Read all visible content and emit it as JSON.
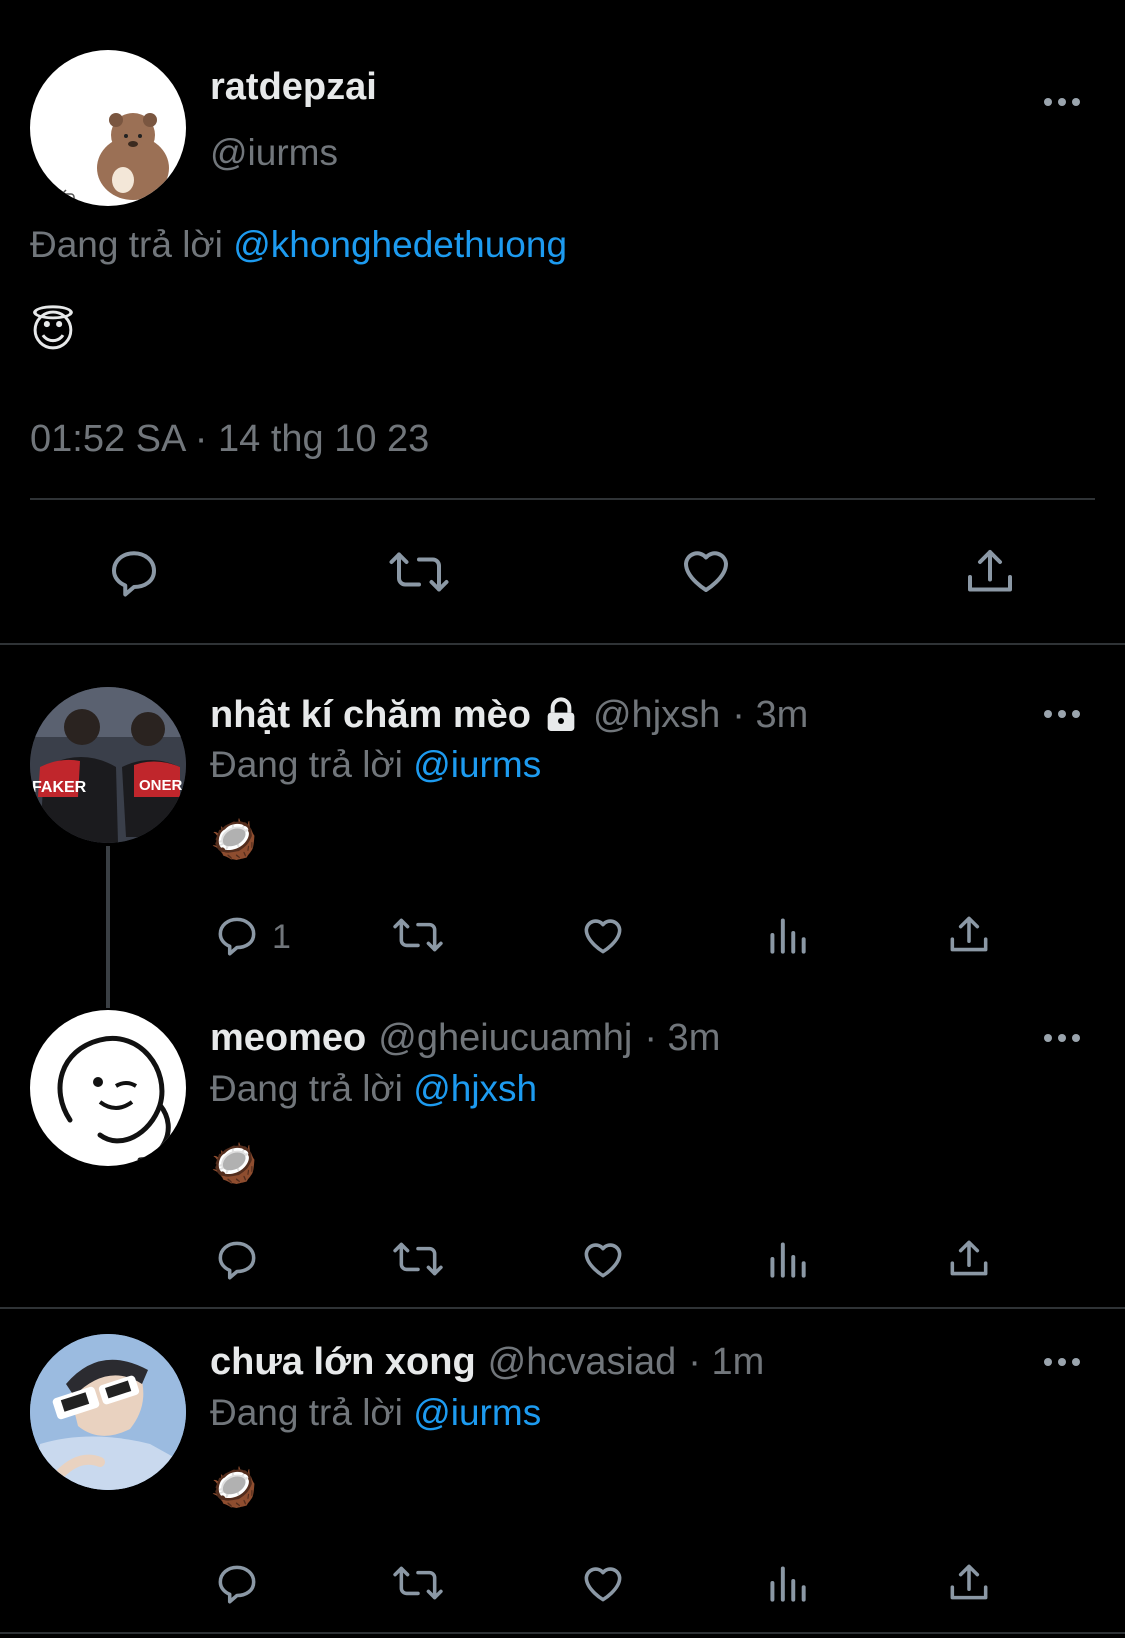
{
  "main_tweet": {
    "display_name": "ratdepzai",
    "handle": "@iurms",
    "replying_prefix": "Đang trả lời",
    "replying_to": "@khonghedethuong",
    "content": "😇",
    "timestamp": "01:52 SA · 14 thg 10 23"
  },
  "replies": [
    {
      "display_name": "nhật kí chăm mèo",
      "handle": "@hjxsh",
      "time": "· 3m",
      "replying_prefix": "Đang trả lời",
      "replying_to": "@iurms",
      "content": "🥥",
      "reply_count": "1",
      "avatar_text_left": "FAKER",
      "avatar_text_right": "ONER"
    },
    {
      "display_name": "meomeo",
      "handle": "@gheiucuamhj",
      "time": "· 3m",
      "replying_prefix": "Đang trả lời",
      "replying_to": "@hjxsh",
      "content": "🥥",
      "reply_count": ""
    },
    {
      "display_name": "chưa lớn xong",
      "handle": "@hcvasiad",
      "time": "· 1m",
      "replying_prefix": "Đang trả lời",
      "replying_to": "@iurms",
      "content": "🥥",
      "reply_count": ""
    }
  ],
  "colors": {
    "background": "#000000",
    "text": "#e7e9ea",
    "muted": "#71767b",
    "link": "#1d9bf0",
    "icon": "#8b98a5",
    "divider": "#2f3336"
  },
  "icons": [
    "reply-icon",
    "retweet-icon",
    "like-icon",
    "share-icon",
    "views-icon",
    "more-icon",
    "lock-icon"
  ]
}
